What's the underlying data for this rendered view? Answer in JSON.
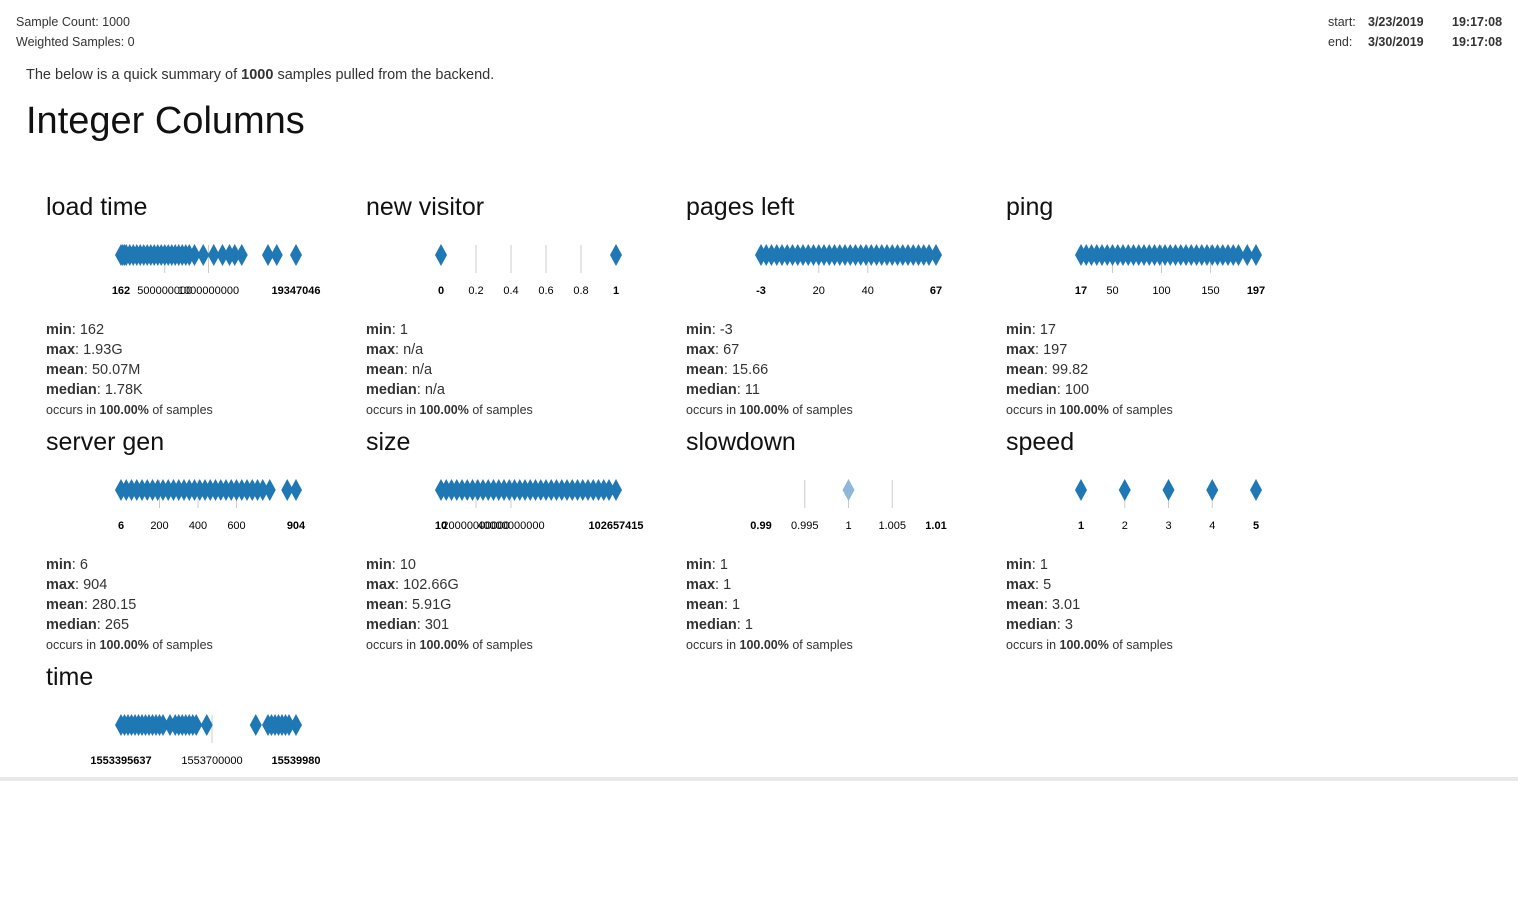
{
  "header": {
    "sample_count": "Sample Count: 1000",
    "weighted_samples": "Weighted Samples: 0",
    "start_label": "start:",
    "start_date": "3/23/2019",
    "start_time": "19:17:08",
    "end_label": "end:",
    "end_date": "3/30/2019",
    "end_time": "19:17:08"
  },
  "intro": {
    "pre": "The below is a quick summary of ",
    "count": "1000",
    "post": " samples pulled from the backend."
  },
  "section_title": "Integer Columns",
  "labels": {
    "min": "min",
    "max": "max",
    "mean": "mean",
    "median": "median",
    "occurs_pre": "occurs in ",
    "occurs_post": " of samples"
  },
  "colors": {
    "marker": "#1f77b4",
    "marker_faint": "#8fb7d9",
    "tick": "#cccccc"
  },
  "columns": [
    {
      "name": "load time",
      "min": "162",
      "max": "1.93G",
      "mean": "50.07M",
      "median": "1.78K",
      "occurs": "100.00%",
      "axis": {
        "ticks": [
          {
            "label": "162",
            "bold": true,
            "pos": 0
          },
          {
            "label": "500000000",
            "bold": false,
            "pos": 0.25
          },
          {
            "label": "1000000000",
            "bold": false,
            "pos": 0.5
          },
          {
            "label": "19347046",
            "bold": true,
            "pos": 1
          }
        ],
        "markers": [
          0,
          0.01,
          0.02,
          0.03,
          0.05,
          0.07,
          0.09,
          0.11,
          0.13,
          0.15,
          0.17,
          0.19,
          0.21,
          0.23,
          0.25,
          0.27,
          0.29,
          0.31,
          0.33,
          0.35,
          0.37,
          0.39,
          0.42,
          0.47,
          0.53,
          0.58,
          0.62,
          0.65,
          0.69,
          0.84,
          0.89,
          1.0
        ],
        "faint": false
      }
    },
    {
      "name": "new visitor",
      "min": "1",
      "max": "n/a",
      "mean": "n/a",
      "median": "n/a",
      "occurs": "100.00%",
      "axis": {
        "ticks": [
          {
            "label": "0",
            "bold": true,
            "pos": 0
          },
          {
            "label": "0.2",
            "bold": false,
            "pos": 0.2
          },
          {
            "label": "0.4",
            "bold": false,
            "pos": 0.4
          },
          {
            "label": "0.6",
            "bold": false,
            "pos": 0.6
          },
          {
            "label": "0.8",
            "bold": false,
            "pos": 0.8
          },
          {
            "label": "1",
            "bold": true,
            "pos": 1
          }
        ],
        "markers": [
          0,
          1
        ],
        "faint": false
      }
    },
    {
      "name": "pages left",
      "min": "-3",
      "max": "67",
      "mean": "15.66",
      "median": "11",
      "occurs": "100.00%",
      "axis": {
        "ticks": [
          {
            "label": "-3",
            "bold": true,
            "pos": 0
          },
          {
            "label": "20",
            "bold": false,
            "pos": 0.33
          },
          {
            "label": "40",
            "bold": false,
            "pos": 0.61
          },
          {
            "label": "67",
            "bold": true,
            "pos": 1
          }
        ],
        "markers": [
          0,
          0.03,
          0.06,
          0.09,
          0.12,
          0.15,
          0.18,
          0.21,
          0.24,
          0.27,
          0.3,
          0.33,
          0.36,
          0.39,
          0.42,
          0.45,
          0.48,
          0.51,
          0.54,
          0.57,
          0.6,
          0.63,
          0.66,
          0.69,
          0.72,
          0.75,
          0.78,
          0.81,
          0.84,
          0.87,
          0.9,
          0.93,
          0.96,
          1.0
        ],
        "faint": false
      }
    },
    {
      "name": "ping",
      "min": "17",
      "max": "197",
      "mean": "99.82",
      "median": "100",
      "occurs": "100.00%",
      "axis": {
        "ticks": [
          {
            "label": "17",
            "bold": true,
            "pos": 0
          },
          {
            "label": "50",
            "bold": false,
            "pos": 0.18
          },
          {
            "label": "100",
            "bold": false,
            "pos": 0.46
          },
          {
            "label": "150",
            "bold": false,
            "pos": 0.74
          },
          {
            "label": "197",
            "bold": true,
            "pos": 1
          }
        ],
        "markers": [
          0,
          0.03,
          0.06,
          0.09,
          0.12,
          0.15,
          0.18,
          0.21,
          0.24,
          0.27,
          0.3,
          0.33,
          0.36,
          0.39,
          0.42,
          0.45,
          0.48,
          0.51,
          0.54,
          0.57,
          0.6,
          0.63,
          0.66,
          0.69,
          0.72,
          0.75,
          0.78,
          0.81,
          0.84,
          0.87,
          0.9,
          0.95,
          1.0
        ],
        "faint": false
      }
    },
    {
      "name": "server gen",
      "min": "6",
      "max": "904",
      "mean": "280.15",
      "median": "265",
      "occurs": "100.00%",
      "axis": {
        "ticks": [
          {
            "label": "6",
            "bold": true,
            "pos": 0
          },
          {
            "label": "200",
            "bold": false,
            "pos": 0.22
          },
          {
            "label": "400",
            "bold": false,
            "pos": 0.44
          },
          {
            "label": "600",
            "bold": false,
            "pos": 0.66
          },
          {
            "label": "904",
            "bold": true,
            "pos": 1
          }
        ],
        "markers": [
          0,
          0.03,
          0.06,
          0.09,
          0.12,
          0.15,
          0.18,
          0.21,
          0.24,
          0.27,
          0.3,
          0.33,
          0.36,
          0.39,
          0.42,
          0.45,
          0.48,
          0.51,
          0.54,
          0.57,
          0.6,
          0.63,
          0.66,
          0.69,
          0.72,
          0.75,
          0.78,
          0.81,
          0.85,
          0.95,
          1.0
        ],
        "faint": false
      }
    },
    {
      "name": "size",
      "min": "10",
      "max": "102.66G",
      "mean": "5.91G",
      "median": "301",
      "occurs": "100.00%",
      "axis": {
        "ticks": [
          {
            "label": "10",
            "bold": true,
            "pos": 0
          },
          {
            "label": "20000000000",
            "bold": false,
            "pos": 0.2
          },
          {
            "label": "40000000000",
            "bold": false,
            "pos": 0.4
          },
          {
            "label": "102657415",
            "bold": true,
            "pos": 1
          }
        ],
        "markers": [
          0,
          0.03,
          0.06,
          0.09,
          0.12,
          0.15,
          0.18,
          0.21,
          0.24,
          0.27,
          0.3,
          0.33,
          0.36,
          0.39,
          0.42,
          0.45,
          0.48,
          0.51,
          0.54,
          0.57,
          0.6,
          0.63,
          0.66,
          0.69,
          0.72,
          0.75,
          0.78,
          0.81,
          0.84,
          0.87,
          0.9,
          0.93,
          0.96,
          1.0
        ],
        "faint": false
      }
    },
    {
      "name": "slowdown",
      "min": "1",
      "max": "1",
      "mean": "1",
      "median": "1",
      "occurs": "100.00%",
      "axis": {
        "ticks": [
          {
            "label": "0.99",
            "bold": true,
            "pos": 0
          },
          {
            "label": "0.995",
            "bold": false,
            "pos": 0.25
          },
          {
            "label": "1",
            "bold": false,
            "pos": 0.5
          },
          {
            "label": "1.005",
            "bold": false,
            "pos": 0.75
          },
          {
            "label": "1.01",
            "bold": true,
            "pos": 1
          }
        ],
        "markers": [
          0.5
        ],
        "faint": true
      }
    },
    {
      "name": "speed",
      "min": "1",
      "max": "5",
      "mean": "3.01",
      "median": "3",
      "occurs": "100.00%",
      "axis": {
        "ticks": [
          {
            "label": "1",
            "bold": true,
            "pos": 0
          },
          {
            "label": "2",
            "bold": false,
            "pos": 0.25
          },
          {
            "label": "3",
            "bold": false,
            "pos": 0.5
          },
          {
            "label": "4",
            "bold": false,
            "pos": 0.75
          },
          {
            "label": "5",
            "bold": true,
            "pos": 1
          }
        ],
        "markers": [
          0,
          0.25,
          0.5,
          0.75,
          1
        ],
        "faint": false
      }
    },
    {
      "name": "time",
      "min": "",
      "max": "",
      "mean": "",
      "median": "",
      "occurs": "",
      "axis": {
        "ticks": [
          {
            "label": "1553395637",
            "bold": true,
            "pos": 0
          },
          {
            "label": "1553700000",
            "bold": false,
            "pos": 0.52
          },
          {
            "label": "15539980",
            "bold": true,
            "pos": 1
          }
        ],
        "markers": [
          0,
          0.02,
          0.04,
          0.06,
          0.08,
          0.1,
          0.12,
          0.14,
          0.16,
          0.18,
          0.2,
          0.22,
          0.24,
          0.28,
          0.31,
          0.33,
          0.35,
          0.37,
          0.39,
          0.41,
          0.43,
          0.49,
          0.77,
          0.84,
          0.86,
          0.88,
          0.9,
          0.92,
          0.94,
          0.96,
          1.0
        ],
        "faint": false
      }
    }
  ]
}
